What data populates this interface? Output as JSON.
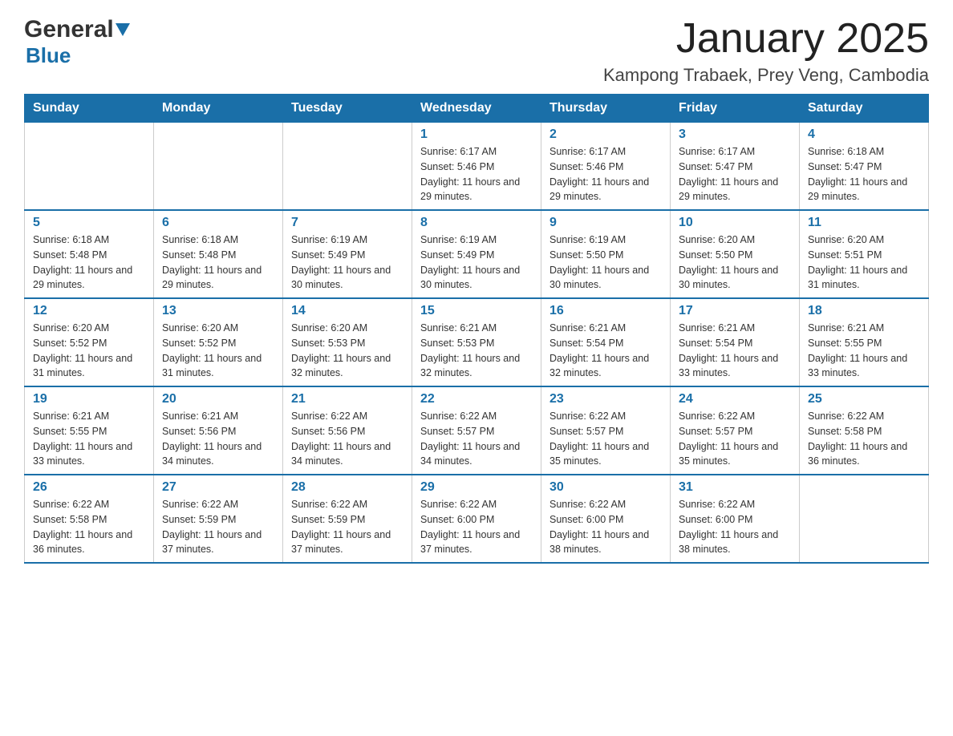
{
  "header": {
    "logo_general": "General",
    "logo_blue": "Blue",
    "calendar_title": "January 2025",
    "calendar_subtitle": "Kampong Trabaek, Prey Veng, Cambodia"
  },
  "days_of_week": [
    "Sunday",
    "Monday",
    "Tuesday",
    "Wednesday",
    "Thursday",
    "Friday",
    "Saturday"
  ],
  "weeks": [
    [
      {
        "day": "",
        "info": ""
      },
      {
        "day": "",
        "info": ""
      },
      {
        "day": "",
        "info": ""
      },
      {
        "day": "1",
        "info": "Sunrise: 6:17 AM\nSunset: 5:46 PM\nDaylight: 11 hours and 29 minutes."
      },
      {
        "day": "2",
        "info": "Sunrise: 6:17 AM\nSunset: 5:46 PM\nDaylight: 11 hours and 29 minutes."
      },
      {
        "day": "3",
        "info": "Sunrise: 6:17 AM\nSunset: 5:47 PM\nDaylight: 11 hours and 29 minutes."
      },
      {
        "day": "4",
        "info": "Sunrise: 6:18 AM\nSunset: 5:47 PM\nDaylight: 11 hours and 29 minutes."
      }
    ],
    [
      {
        "day": "5",
        "info": "Sunrise: 6:18 AM\nSunset: 5:48 PM\nDaylight: 11 hours and 29 minutes."
      },
      {
        "day": "6",
        "info": "Sunrise: 6:18 AM\nSunset: 5:48 PM\nDaylight: 11 hours and 29 minutes."
      },
      {
        "day": "7",
        "info": "Sunrise: 6:19 AM\nSunset: 5:49 PM\nDaylight: 11 hours and 30 minutes."
      },
      {
        "day": "8",
        "info": "Sunrise: 6:19 AM\nSunset: 5:49 PM\nDaylight: 11 hours and 30 minutes."
      },
      {
        "day": "9",
        "info": "Sunrise: 6:19 AM\nSunset: 5:50 PM\nDaylight: 11 hours and 30 minutes."
      },
      {
        "day": "10",
        "info": "Sunrise: 6:20 AM\nSunset: 5:50 PM\nDaylight: 11 hours and 30 minutes."
      },
      {
        "day": "11",
        "info": "Sunrise: 6:20 AM\nSunset: 5:51 PM\nDaylight: 11 hours and 31 minutes."
      }
    ],
    [
      {
        "day": "12",
        "info": "Sunrise: 6:20 AM\nSunset: 5:52 PM\nDaylight: 11 hours and 31 minutes."
      },
      {
        "day": "13",
        "info": "Sunrise: 6:20 AM\nSunset: 5:52 PM\nDaylight: 11 hours and 31 minutes."
      },
      {
        "day": "14",
        "info": "Sunrise: 6:20 AM\nSunset: 5:53 PM\nDaylight: 11 hours and 32 minutes."
      },
      {
        "day": "15",
        "info": "Sunrise: 6:21 AM\nSunset: 5:53 PM\nDaylight: 11 hours and 32 minutes."
      },
      {
        "day": "16",
        "info": "Sunrise: 6:21 AM\nSunset: 5:54 PM\nDaylight: 11 hours and 32 minutes."
      },
      {
        "day": "17",
        "info": "Sunrise: 6:21 AM\nSunset: 5:54 PM\nDaylight: 11 hours and 33 minutes."
      },
      {
        "day": "18",
        "info": "Sunrise: 6:21 AM\nSunset: 5:55 PM\nDaylight: 11 hours and 33 minutes."
      }
    ],
    [
      {
        "day": "19",
        "info": "Sunrise: 6:21 AM\nSunset: 5:55 PM\nDaylight: 11 hours and 33 minutes."
      },
      {
        "day": "20",
        "info": "Sunrise: 6:21 AM\nSunset: 5:56 PM\nDaylight: 11 hours and 34 minutes."
      },
      {
        "day": "21",
        "info": "Sunrise: 6:22 AM\nSunset: 5:56 PM\nDaylight: 11 hours and 34 minutes."
      },
      {
        "day": "22",
        "info": "Sunrise: 6:22 AM\nSunset: 5:57 PM\nDaylight: 11 hours and 34 minutes."
      },
      {
        "day": "23",
        "info": "Sunrise: 6:22 AM\nSunset: 5:57 PM\nDaylight: 11 hours and 35 minutes."
      },
      {
        "day": "24",
        "info": "Sunrise: 6:22 AM\nSunset: 5:57 PM\nDaylight: 11 hours and 35 minutes."
      },
      {
        "day": "25",
        "info": "Sunrise: 6:22 AM\nSunset: 5:58 PM\nDaylight: 11 hours and 36 minutes."
      }
    ],
    [
      {
        "day": "26",
        "info": "Sunrise: 6:22 AM\nSunset: 5:58 PM\nDaylight: 11 hours and 36 minutes."
      },
      {
        "day": "27",
        "info": "Sunrise: 6:22 AM\nSunset: 5:59 PM\nDaylight: 11 hours and 37 minutes."
      },
      {
        "day": "28",
        "info": "Sunrise: 6:22 AM\nSunset: 5:59 PM\nDaylight: 11 hours and 37 minutes."
      },
      {
        "day": "29",
        "info": "Sunrise: 6:22 AM\nSunset: 6:00 PM\nDaylight: 11 hours and 37 minutes."
      },
      {
        "day": "30",
        "info": "Sunrise: 6:22 AM\nSunset: 6:00 PM\nDaylight: 11 hours and 38 minutes."
      },
      {
        "day": "31",
        "info": "Sunrise: 6:22 AM\nSunset: 6:00 PM\nDaylight: 11 hours and 38 minutes."
      },
      {
        "day": "",
        "info": ""
      }
    ]
  ]
}
